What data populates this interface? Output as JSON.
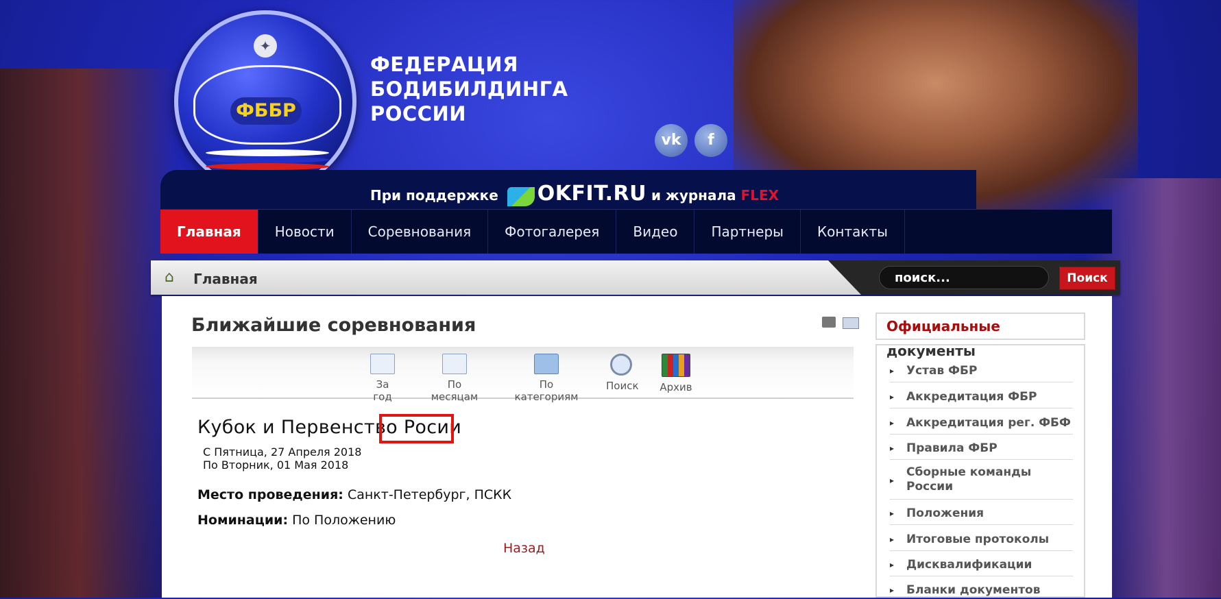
{
  "header": {
    "logo_text": "ФББР",
    "title_lines": [
      "ФЕДЕРАЦИЯ",
      "БОДИБИЛДИНГА",
      "РОССИИ"
    ],
    "support_prefix": "При поддержке",
    "support_brand": "OKFIT.RU",
    "support_middle": "и журнала",
    "support_magazine": "FLEX",
    "social": [
      {
        "name": "vk-icon",
        "label": "vk"
      },
      {
        "name": "facebook-icon",
        "label": "f"
      }
    ]
  },
  "nav": {
    "items": [
      {
        "label": "Главная",
        "active": true
      },
      {
        "label": "Новости"
      },
      {
        "label": "Соревнования"
      },
      {
        "label": "Фотогалерея"
      },
      {
        "label": "Видео"
      },
      {
        "label": "Партнеры"
      },
      {
        "label": "Контакты"
      }
    ]
  },
  "breadcrumb": {
    "label": "Главная"
  },
  "search": {
    "placeholder": "поиск...",
    "button_label": "Поиск"
  },
  "main": {
    "heading": "Ближайшие соревнования",
    "toolbar": {
      "year": "За год",
      "month": "По месяцам",
      "category": "По категориям",
      "search": "Поиск",
      "archive": "Архив"
    },
    "event": {
      "title": "Кубок и Первенство Росии",
      "date_from": "С Пятница, 27 Апреля 2018",
      "date_to": "По Вторник, 01 Мая 2018",
      "place_label": "Место проведения:",
      "place_value": "Санкт-Петербург, ПСКК",
      "nominations_label": "Номинации:",
      "nominations_value": "По Положению"
    },
    "back_label": "Назад"
  },
  "sidebar": {
    "title_highlight": "Официальные",
    "title_rest": "документы",
    "items": [
      "Устав ФБР",
      "Аккредитация ФБР",
      "Аккредитация рег. ФБФ",
      "Правила ФБР",
      "Сборные команды России",
      "Положения",
      "Итоговые протоколы",
      "Дисквалификации",
      "Бланки документов"
    ]
  },
  "colors": {
    "nav_active": "#e3131d",
    "highlight_box": "#e21313",
    "back_link": "#9a1d1d",
    "sidebar_highlight": "#a80d0d"
  }
}
